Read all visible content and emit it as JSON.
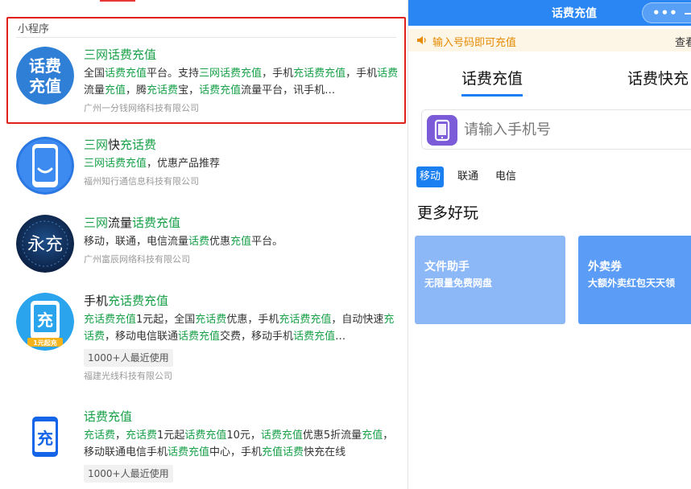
{
  "search": {
    "section_label": "小程序",
    "results": [
      {
        "title_parts": [
          "三网话费充值"
        ],
        "desc": [
          {
            "t": "全国",
            "k": false
          },
          {
            "t": "话费充值",
            "k": true
          },
          {
            "t": "平台。支持",
            "k": false
          },
          {
            "t": "三网话费充值",
            "k": true
          },
          {
            "t": "，手机",
            "k": false
          },
          {
            "t": "充话费充值",
            "k": true
          },
          {
            "t": "，手机",
            "k": false
          },
          {
            "t": "话费",
            "k": true
          },
          {
            "t": "流量",
            "k": false
          },
          {
            "t": "充值",
            "k": true
          },
          {
            "t": "，腾",
            "k": false
          },
          {
            "t": "充话费",
            "k": true
          },
          {
            "t": "宝，",
            "k": false
          },
          {
            "t": "话费充值",
            "k": true
          },
          {
            "t": "流量平台，讯手机…",
            "k": false
          }
        ],
        "company": "广州一分钱网络科技有限公司"
      },
      {
        "title": [
          {
            "t": "三网",
            "k": true
          },
          {
            "t": "快",
            "k": false
          },
          {
            "t": "充话费",
            "k": true
          }
        ],
        "desc": [
          {
            "t": "三网话费充值",
            "k": true
          },
          {
            "t": "，优惠产品推荐",
            "k": false
          }
        ],
        "company": "福州知行通信息科技有限公司"
      },
      {
        "title": [
          {
            "t": "三网",
            "k": true
          },
          {
            "t": "流量",
            "k": false
          },
          {
            "t": "话费充值",
            "k": true
          }
        ],
        "desc": [
          {
            "t": "移动，联通，电信流量",
            "k": false
          },
          {
            "t": "话费",
            "k": true
          },
          {
            "t": "优惠",
            "k": false
          },
          {
            "t": "充值",
            "k": true
          },
          {
            "t": "平台。",
            "k": false
          }
        ],
        "company": "广州富辰网络科技有限公司"
      },
      {
        "title": [
          {
            "t": "手机",
            "k": false
          },
          {
            "t": "充话费充值",
            "k": true
          }
        ],
        "desc": [
          {
            "t": "充话费充值",
            "k": true
          },
          {
            "t": "1元起，全国",
            "k": false
          },
          {
            "t": "充话费",
            "k": true
          },
          {
            "t": "优惠，手机",
            "k": false
          },
          {
            "t": "充话费充值",
            "k": true
          },
          {
            "t": "，自动快速",
            "k": false
          },
          {
            "t": "充话费",
            "k": true
          },
          {
            "t": "，移动电信联通",
            "k": false
          },
          {
            "t": "话费充值",
            "k": true
          },
          {
            "t": "交费，移动手机",
            "k": false
          },
          {
            "t": "话费充值",
            "k": true
          },
          {
            "t": "…",
            "k": false
          }
        ],
        "usage": "1000+人最近使用",
        "company": "福建光线科技有限公司"
      },
      {
        "title": [
          {
            "t": "话费充值",
            "k": true
          }
        ],
        "desc": [
          {
            "t": "充话费",
            "k": true
          },
          {
            "t": "，",
            "k": false
          },
          {
            "t": "充话费",
            "k": true
          },
          {
            "t": "1元起",
            "k": false
          },
          {
            "t": "话费充值",
            "k": true
          },
          {
            "t": "10元，",
            "k": false
          },
          {
            "t": "话费充值",
            "k": true
          },
          {
            "t": "优惠5折流量",
            "k": false
          },
          {
            "t": "充值",
            "k": true
          },
          {
            "t": "，移动联通电信手机",
            "k": false
          },
          {
            "t": "话费充值",
            "k": true
          },
          {
            "t": "中心，手机",
            "k": false
          },
          {
            "t": "充值话费",
            "k": true
          },
          {
            "t": "快充在线",
            "k": false
          }
        ],
        "usage": "1000+人最近使用"
      }
    ]
  },
  "logos": {
    "r1_line1": "话费",
    "r1_line2": "充值",
    "r3_text": "永充",
    "r4_glyph": "充",
    "r4_caption": "1元起充",
    "r5_glyph": "充"
  },
  "miniapp": {
    "title": "话费充值",
    "capsule_dots": "•••",
    "notice": "输入号码即可充值",
    "notice_more": "查看",
    "tabs": [
      "话费充值",
      "话费快充"
    ],
    "phone_placeholder": "请输入手机号",
    "carriers": [
      "移动",
      "联通",
      "电信"
    ],
    "section_title": "更多好玩",
    "cards": [
      {
        "title": "文件助手",
        "subtitle": "无限量免费网盘"
      },
      {
        "title": "外卖券",
        "subtitle": "大额外卖红包天天领"
      }
    ],
    "colors": {
      "nav": "#2a86f3",
      "accent": "#1a7ff0",
      "keyword": "#1aa14a",
      "highlight_border": "#e0201b",
      "notice_text": "#e68a00"
    }
  }
}
